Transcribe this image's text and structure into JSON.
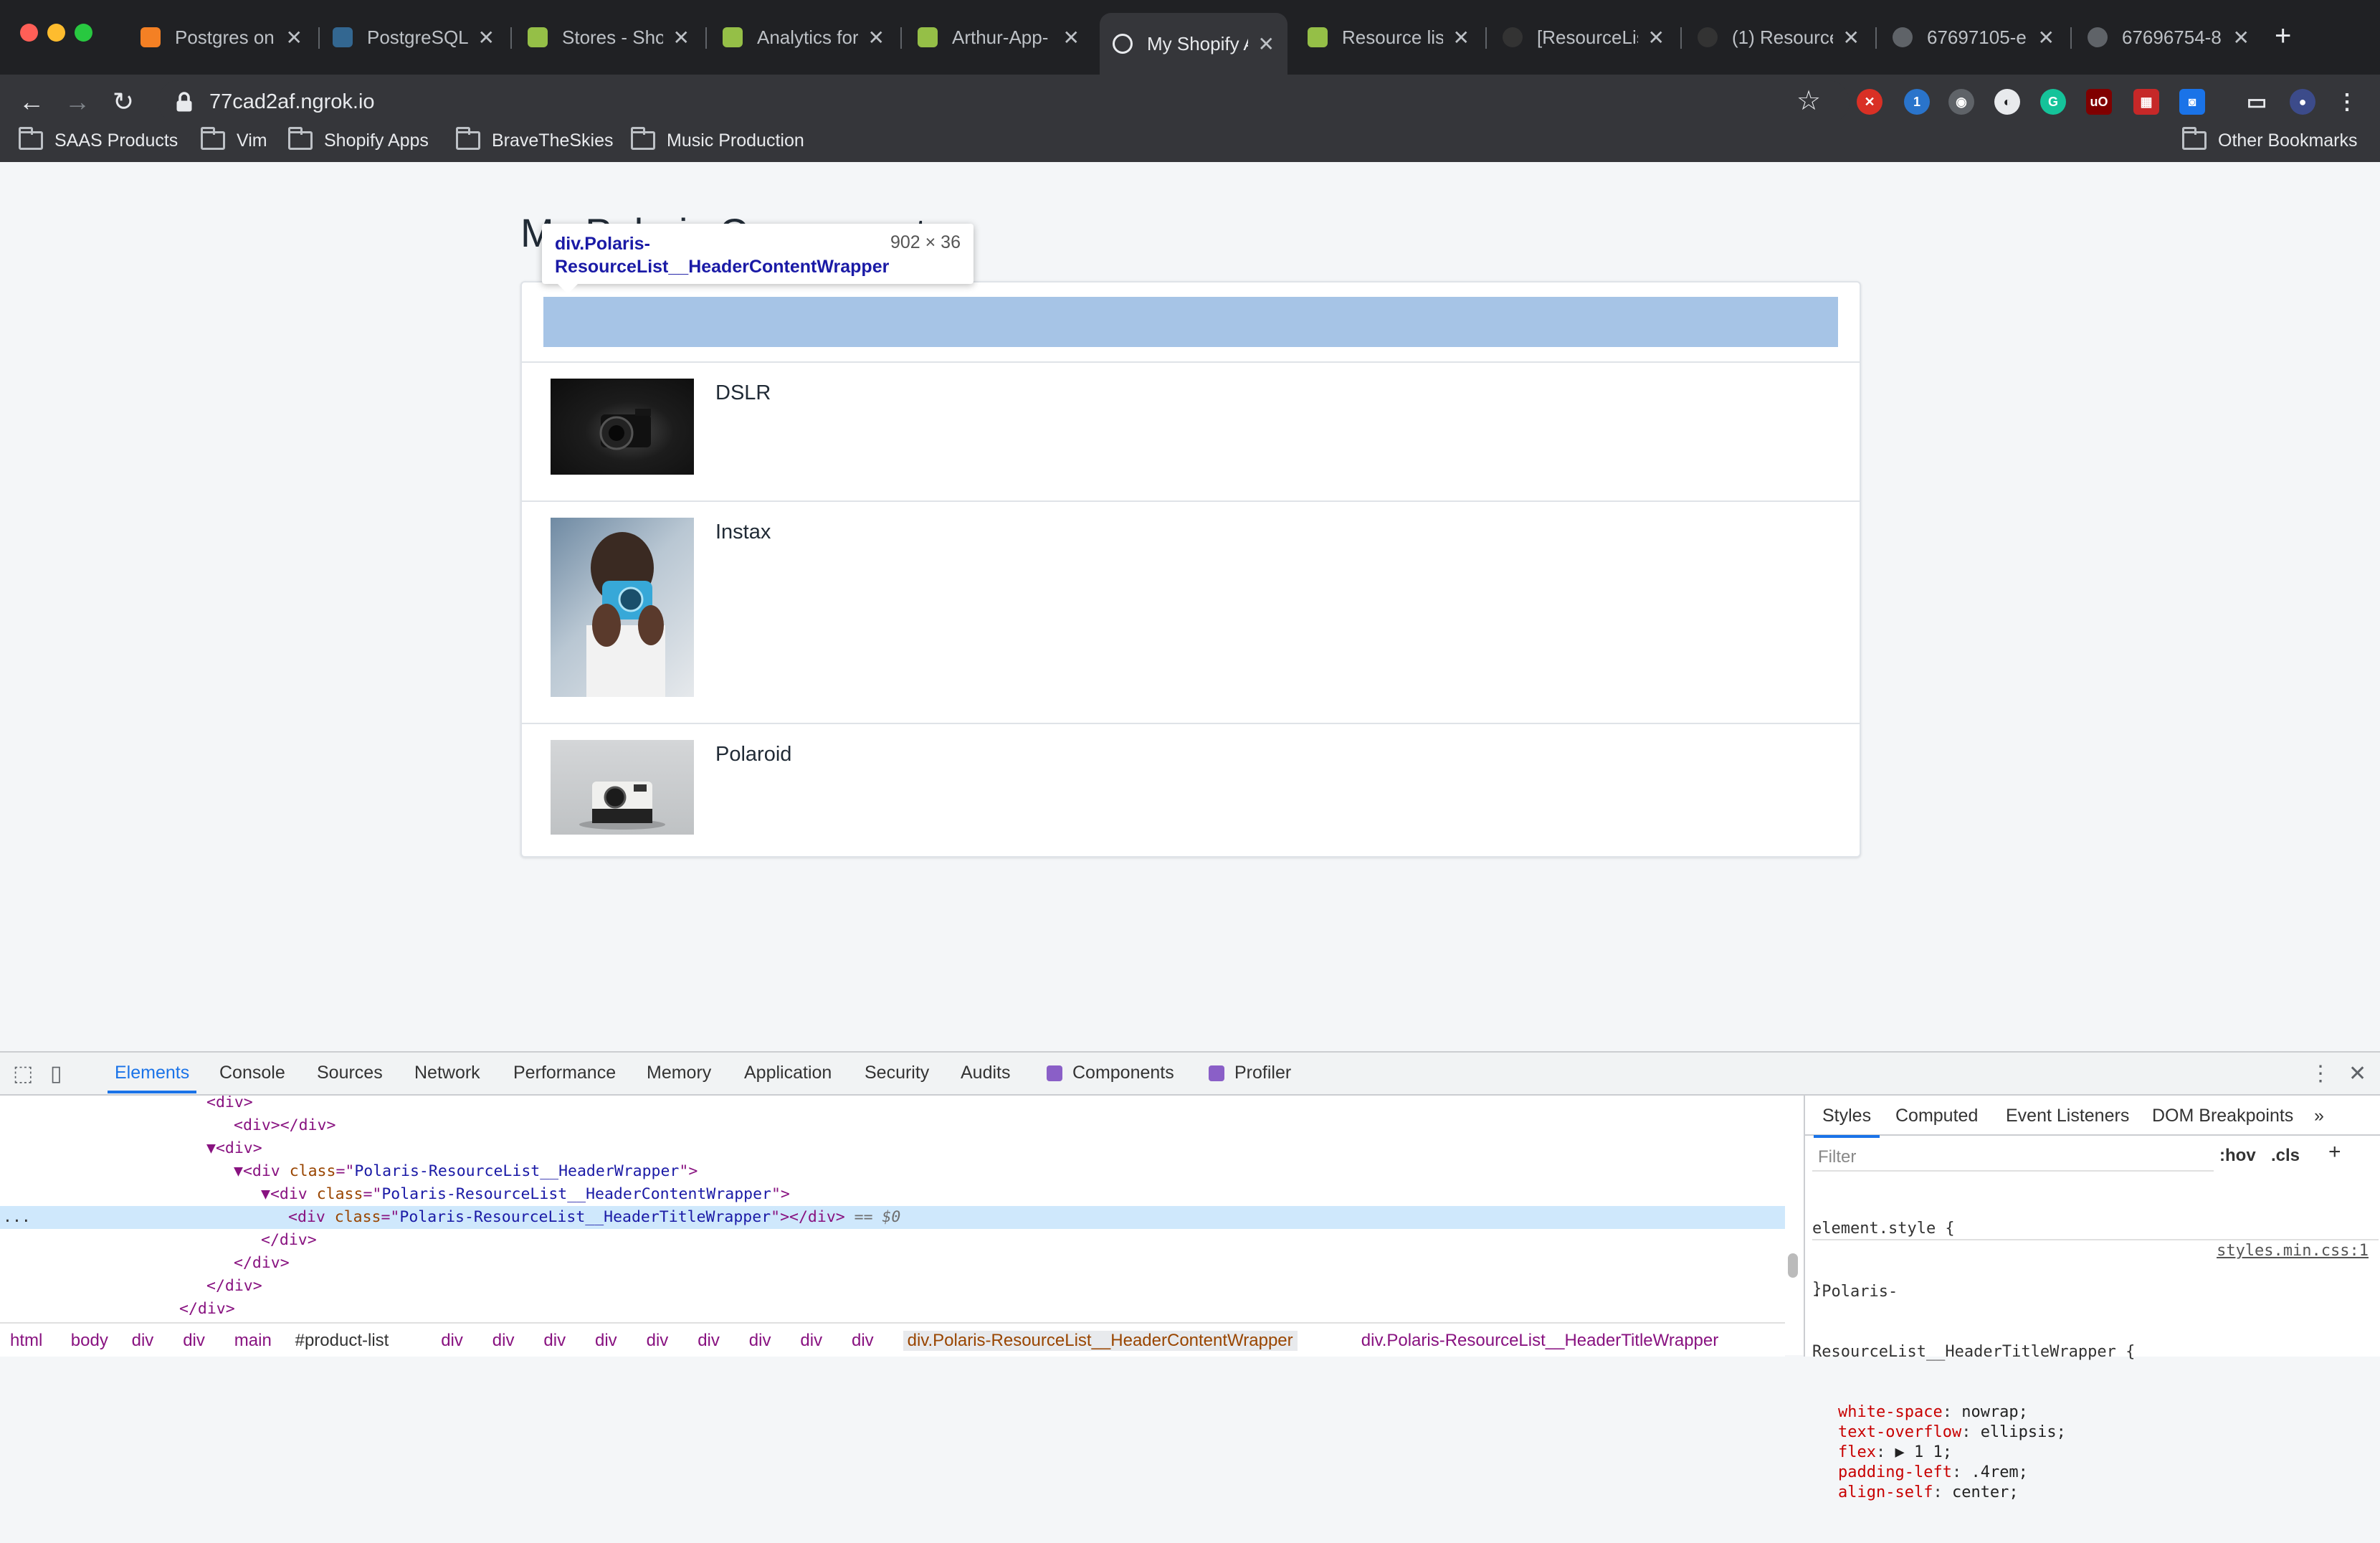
{
  "browser": {
    "tabs": [
      {
        "label": "Postgres on",
        "icon": "stackoverflow-icon",
        "color": "#f48024"
      },
      {
        "label": "PostgreSQL",
        "icon": "postgres-icon",
        "color": "#336791"
      },
      {
        "label": "Stores - Sho",
        "icon": "shopify-icon",
        "color": "#95bf47"
      },
      {
        "label": "Analytics for",
        "icon": "shopify-icon",
        "color": "#95bf47"
      },
      {
        "label": "Arthur-App-",
        "icon": "shopify-icon",
        "color": "#95bf47"
      },
      {
        "label": "My Shopify A",
        "icon": "globe-icon",
        "color": "#ffffff"
      },
      {
        "label": "Resource list",
        "icon": "shopify-icon",
        "color": "#95bf47"
      },
      {
        "label": "[ResourceLis",
        "icon": "github-icon",
        "color": "#333333"
      },
      {
        "label": "(1) Resource",
        "icon": "github-icon",
        "color": "#333333"
      },
      {
        "label": "67697105-e",
        "icon": "globe-icon",
        "color": "#5f6368"
      },
      {
        "label": "67696754-8",
        "icon": "globe-icon",
        "color": "#5f6368"
      }
    ],
    "active_tab_index": 5,
    "url": "77cad2af.ngrok.io",
    "bookmarks": [
      "SAAS Products",
      "Vim",
      "Shopify Apps",
      "BraveTheSkies",
      "Music Production"
    ],
    "other_bookmarks": "Other Bookmarks"
  },
  "page": {
    "title": "My Polaris Component",
    "items": [
      {
        "name": "DSLR"
      },
      {
        "name": "Instax"
      },
      {
        "name": "Polaroid"
      }
    ]
  },
  "inspector_tooltip": {
    "selector": "div.Polaris-ResourceList__HeaderContentWrapper",
    "size": "902 × 36"
  },
  "devtools": {
    "tabs": [
      "Elements",
      "Console",
      "Sources",
      "Network",
      "Performance",
      "Memory",
      "Application",
      "Security",
      "Audits",
      "Components",
      "Profiler"
    ],
    "dom_lines": [
      {
        "indent": 6,
        "text": "<div>"
      },
      {
        "indent": 7,
        "text": "<div></div>"
      },
      {
        "indent": 6,
        "text": "▼<div>"
      },
      {
        "indent": 7,
        "tag": "div",
        "attr": "class",
        "val": "Polaris-ResourceList__HeaderWrapper",
        "arrow": "▼"
      },
      {
        "indent": 8,
        "tag": "div",
        "attr": "class",
        "val": "Polaris-ResourceList__HeaderContentWrapper",
        "arrow": "▼"
      },
      {
        "indent": 9,
        "tag": "div",
        "attr": "class",
        "val": "Polaris-ResourceList__HeaderTitleWrapper",
        "close": "></div>",
        "ref": " == $0",
        "selected": true
      },
      {
        "indent": 8,
        "text": "</div>"
      },
      {
        "indent": 7,
        "text": "</div>"
      },
      {
        "indent": 6,
        "text": "</div>"
      },
      {
        "indent": 5,
        "text": "</div>"
      }
    ],
    "breadcrumbs": [
      "html",
      "body",
      "div",
      "div",
      "main",
      "#product-list",
      "div",
      "div",
      "div",
      "div",
      "div",
      "div",
      "div",
      "div",
      "div",
      "div.Polaris-ResourceList__HeaderContentWrapper",
      "div.Polaris-ResourceList__HeaderTitleWrapper"
    ],
    "styles_tabs": [
      "Styles",
      "Computed",
      "Event Listeners",
      "DOM Breakpoints"
    ],
    "filter_placeholder": "Filter",
    "hov": ":hov",
    "cls": ".cls",
    "element_style": "element.style {",
    "element_style_close": "}",
    "rule_selector_1": ".Polaris-",
    "rule_selector_2": "ResourceList__HeaderTitleWrapper {",
    "rule_source": "styles.min.css:1",
    "properties": [
      {
        "prop": "white-space",
        "val": "nowrap;"
      },
      {
        "prop": "text-overflow",
        "val": "ellipsis;"
      },
      {
        "prop": "flex",
        "val": "▶ 1 1;"
      },
      {
        "prop": "padding-left",
        "val": ".4rem;"
      },
      {
        "prop": "align-self",
        "val": "center;"
      }
    ]
  },
  "colors": {
    "highlight": "#a6c4e6",
    "accent": "#1a73e8",
    "chrome_bg": "#202124"
  }
}
